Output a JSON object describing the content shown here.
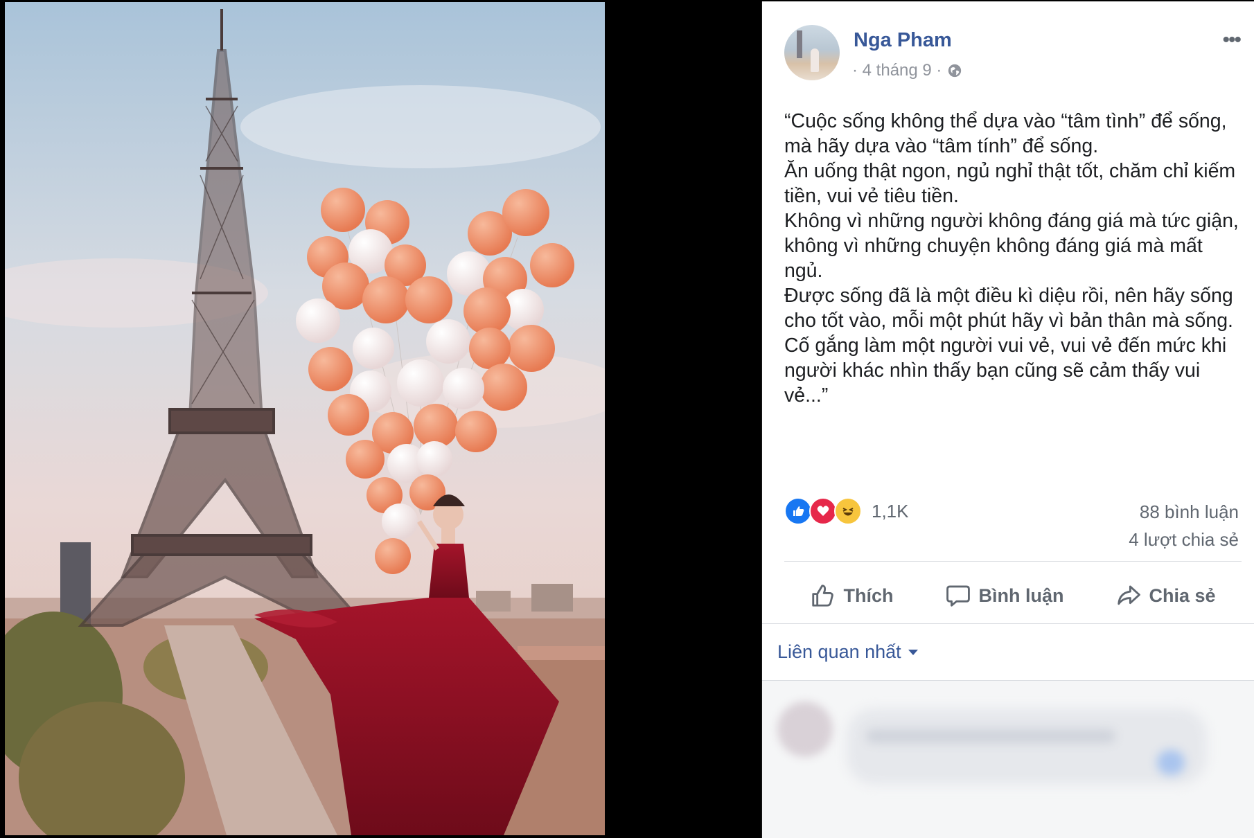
{
  "post": {
    "author": "Nga Pham",
    "date": "· 4 tháng 9 ·",
    "more_glyph": "•••",
    "text": [
      "“Cuộc sống không thể dựa vào “tâm tình” để sống, mà hãy dựa vào “tâm tính” để sống.",
      "Ăn uống thật ngon, ngủ nghỉ thật tốt, chăm chỉ kiếm tiền, vui vẻ tiêu tiền.",
      "Không vì những người không đáng giá mà tức giận, không vì những chuyện không đáng giá mà mất ngủ.",
      "Được sống đã là một điều kì diệu rồi, nên hãy sống cho tốt vào, mỗi một phút hãy vì bản thân mà sống.",
      "Cố gắng làm một người vui vẻ, vui vẻ đến mức khi người khác nhìn thấy bạn cũng sẽ cảm thấy vui vẻ...”"
    ]
  },
  "stats": {
    "reaction_count": "1,1K",
    "comments": "88 bình luận",
    "shares": "4 lượt chia sẻ",
    "reaction_icons": [
      "like-icon",
      "love-icon",
      "haha-icon"
    ]
  },
  "actions": {
    "like": "Thích",
    "comment": "Bình luận",
    "share": "Chia sẻ"
  },
  "comments": {
    "sort_label": "Liên quan nhất"
  },
  "colors": {
    "link": "#385898",
    "muted": "#606770",
    "like_blue": "#1877f2",
    "love_red": "#e6284a",
    "haha_yellow": "#f7c53d"
  }
}
